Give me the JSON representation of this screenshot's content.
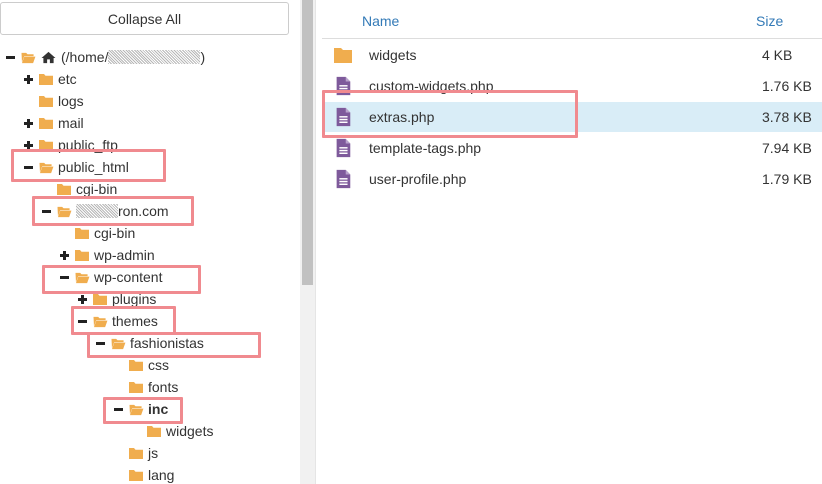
{
  "left_pane": {
    "collapse_label": "Collapse All",
    "tree": [
      {
        "label": "(/home/",
        "suffix": ")",
        "type": "home"
      },
      {
        "label": "etc"
      },
      {
        "label": "logs"
      },
      {
        "label": "mail"
      },
      {
        "label": "public_ftp"
      },
      {
        "label": "public_html"
      },
      {
        "label": "cgi-bin"
      },
      {
        "label": "ron.com"
      },
      {
        "label": "cgi-bin"
      },
      {
        "label": "wp-admin"
      },
      {
        "label": "wp-content"
      },
      {
        "label": "plugins"
      },
      {
        "label": "themes"
      },
      {
        "label": "fashionistas"
      },
      {
        "label": "css"
      },
      {
        "label": "fonts"
      },
      {
        "label": "inc"
      },
      {
        "label": "widgets"
      },
      {
        "label": "js"
      },
      {
        "label": "lang"
      }
    ]
  },
  "right_pane": {
    "header": {
      "name": "Name",
      "size": "Size"
    },
    "files": [
      {
        "name": "widgets",
        "size": "4 KB",
        "kind": "folder-icon"
      },
      {
        "name": "custom-widgets.php",
        "size": "1.76 KB",
        "kind": "php-file-icon"
      },
      {
        "name": "extras.php",
        "size": "3.78 KB",
        "kind": "php-file-icon",
        "selected": true
      },
      {
        "name": "template-tags.php",
        "size": "7.94 KB",
        "kind": "php-file-icon"
      },
      {
        "name": "user-profile.php",
        "size": "1.79 KB",
        "kind": "php-file-icon"
      }
    ]
  },
  "colors": {
    "folder": "#f0ad4e",
    "file_icon": "#7e5a9b",
    "link": "#337ab7",
    "selected_row": "#d9edf7",
    "highlight_box": "#f08a8f"
  }
}
